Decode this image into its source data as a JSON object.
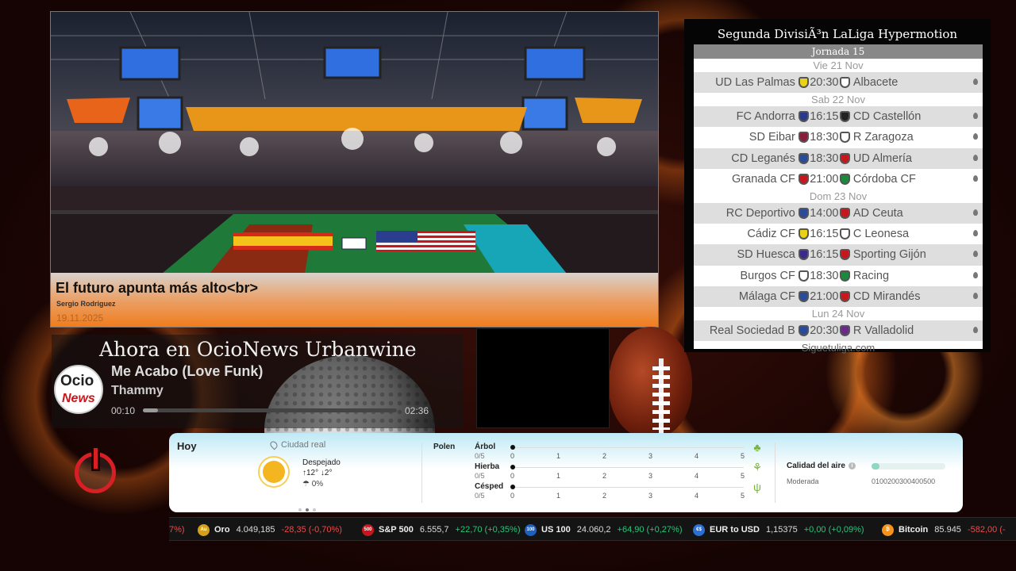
{
  "news": {
    "headline": "El futuro apunta más alto<br>",
    "author": "Sergio Rodriguez",
    "date": "19.11.2025"
  },
  "player": {
    "header": "Ahora en OcioNews Urbanwine",
    "logo_top": "Ocio",
    "logo_bottom": "News",
    "track": "Me Acabo (Love Funk)",
    "artist": "Thammy",
    "elapsed": "00:10",
    "duration": "02:36",
    "progress": 0.06
  },
  "league": {
    "title": "Segunda DivisiÃ³n LaLiga Hypermotion",
    "jornada": "Jornada 15",
    "days": [
      {
        "label": "Vie 21 Nov",
        "matches": [
          {
            "home": "UD Las Palmas",
            "time": "20:30",
            "away": "Albacete",
            "home_color": "#e8d21a",
            "away_color": "#ffffff"
          }
        ]
      },
      {
        "label": "Sab 22 Nov",
        "matches": [
          {
            "home": "FC Andorra",
            "time": "16:15",
            "away": "CD Castellón",
            "home_color": "#2a3a8a",
            "away_color": "#222222"
          },
          {
            "home": "SD Eibar",
            "time": "18:30",
            "away": "R Zaragoza",
            "home_color": "#8a1d3a",
            "away_color": "#ffffff"
          },
          {
            "home": "CD Leganés",
            "time": "18:30",
            "away": "UD Almería",
            "home_color": "#2a4a9a",
            "away_color": "#c8161d"
          },
          {
            "home": "Granada CF",
            "time": "21:00",
            "away": "Córdoba CF",
            "home_color": "#c8161d",
            "away_color": "#1a8a3a"
          }
        ]
      },
      {
        "label": "Dom 23 Nov",
        "matches": [
          {
            "home": "RC Deportivo",
            "time": "14:00",
            "away": "AD Ceuta",
            "home_color": "#2a4a9a",
            "away_color": "#c8161d"
          },
          {
            "home": "Cádiz CF",
            "time": "16:15",
            "away": "C Leonesa",
            "home_color": "#e8d21a",
            "away_color": "#ffffff"
          },
          {
            "home": "SD Huesca",
            "time": "16:15",
            "away": "Sporting Gijón",
            "home_color": "#3a2a8a",
            "away_color": "#c8161d"
          },
          {
            "home": "Burgos CF",
            "time": "18:30",
            "away": "Racing",
            "home_color": "#ffffff",
            "away_color": "#1a8a3a"
          },
          {
            "home": "Málaga CF",
            "time": "21:00",
            "away": "CD Mirandés",
            "home_color": "#2a4a9a",
            "away_color": "#c8161d"
          }
        ]
      },
      {
        "label": "Lun 24 Nov",
        "matches": [
          {
            "home": "Real Sociedad B",
            "time": "20:30",
            "away": "R Valladolid",
            "home_color": "#2a4a9a",
            "away_color": "#6a2a8a"
          }
        ]
      }
    ],
    "footer": "Siguetuliga.com"
  },
  "weather": {
    "today": "Hoy",
    "location": "Ciudad real",
    "condition": "Despejado",
    "max": "↑12°",
    "min": "↓2°",
    "rain": "0%",
    "polen_label": "Polen",
    "polen": [
      {
        "name": "Árbol",
        "value": "0/5",
        "level": 0,
        "icon": "tree-icon"
      },
      {
        "name": "Hierba",
        "value": "0/5",
        "level": 0,
        "icon": "weed-icon"
      },
      {
        "name": "Césped",
        "value": "0/5",
        "level": 0,
        "icon": "grass-icon"
      }
    ],
    "polen_ticks": [
      "0",
      "1",
      "2",
      "3",
      "4",
      "5"
    ],
    "air_title": "Calidad del aire",
    "air_state": "Moderada",
    "air_scale": "0100200300400500"
  },
  "ticker": [
    {
      "name": "",
      "price": "",
      "change": "7%)",
      "dir": "neg",
      "icon": "",
      "color": ""
    },
    {
      "name": "Oro",
      "price": "4.049,185",
      "change": "-28,35 (-0,70%)",
      "dir": "neg",
      "icon": "gold-icon",
      "color": "#d4a017",
      "badge": "Au"
    },
    {
      "name": "S&P 500",
      "price": "6.555,7",
      "change": "+22,70 (+0,35%)",
      "dir": "pos",
      "icon": "sp500-icon",
      "color": "#c8161d",
      "badge": "500",
      "price_dir": "neg"
    },
    {
      "name": "US 100",
      "price": "24.060,2",
      "change": "+64,90 (+0,27%)",
      "dir": "pos",
      "icon": "us100-icon",
      "color": "#1f5fbf",
      "badge": "100",
      "price_dir": "pos"
    },
    {
      "name": "EUR to USD",
      "price": "1,15375",
      "change": "+0,00 (+0,09%)",
      "dir": "pos",
      "icon": "currency-icon",
      "color": "#2a6fd1",
      "badge": "€$"
    },
    {
      "name": "Bitcoin",
      "price": "85.945",
      "change": "-582,00 (-",
      "dir": "neg",
      "icon": "bitcoin-icon",
      "color": "#f7931a",
      "badge": "₿"
    }
  ]
}
